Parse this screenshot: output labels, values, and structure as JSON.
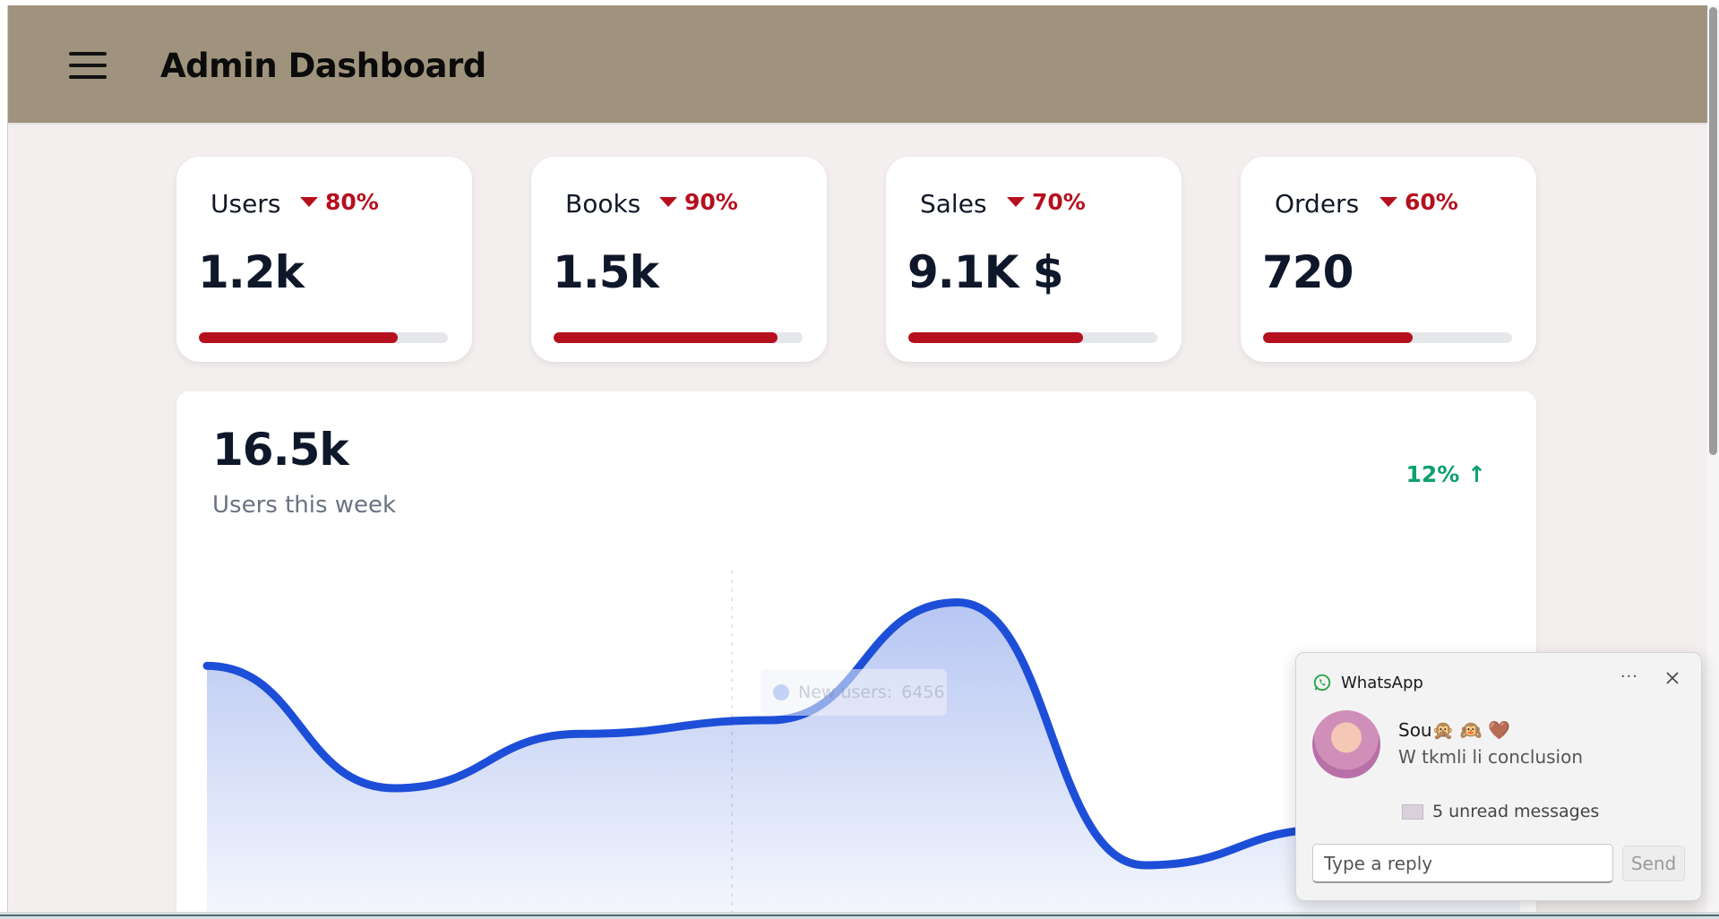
{
  "header": {
    "title": "Admin Dashboard"
  },
  "stats": [
    {
      "label": "Users",
      "delta": "80%",
      "value": "1.2k",
      "progress": 0.8
    },
    {
      "label": "Books",
      "delta": "90%",
      "value": "1.5k",
      "progress": 0.9
    },
    {
      "label": "Sales",
      "delta": "70%",
      "value": "9.1K $",
      "progress": 0.7
    },
    {
      "label": "Orders",
      "delta": "60%",
      "value": "720",
      "progress": 0.6
    }
  ],
  "weekly": {
    "total": "16.5k",
    "subtitle": "Users this week",
    "growth": "12% ↑",
    "tooltip_label": "New users:",
    "tooltip_value": "6456"
  },
  "chart_data": {
    "type": "area",
    "x": [
      0,
      1,
      2,
      3,
      4,
      5,
      6,
      7
    ],
    "values": [
      6200,
      3500,
      4700,
      5000,
      7600,
      1800,
      2600,
      4000
    ],
    "ylim": [
      0,
      8500
    ],
    "color": "#1d4ed8",
    "grid": false
  },
  "notification": {
    "app": "WhatsApp",
    "sender": "Sou🙊 🙉 🤎",
    "message": "W tkmli li conclusion",
    "unread": "5 unread messages",
    "reply_placeholder": "Type a reply",
    "send_label": "Send",
    "more_label": "···"
  },
  "colors": {
    "topbar": "#a0937d",
    "background": "#f4efef",
    "accent_red": "#b5101e",
    "accent_green": "#0e9f6e",
    "chart_blue": "#1d4ed8"
  },
  "icons": {
    "menu": "hamburger-icon",
    "delta": "triangle-down-icon",
    "whatsapp": "whatsapp-icon",
    "close": "close-icon",
    "envelope": "envelope-icon"
  }
}
